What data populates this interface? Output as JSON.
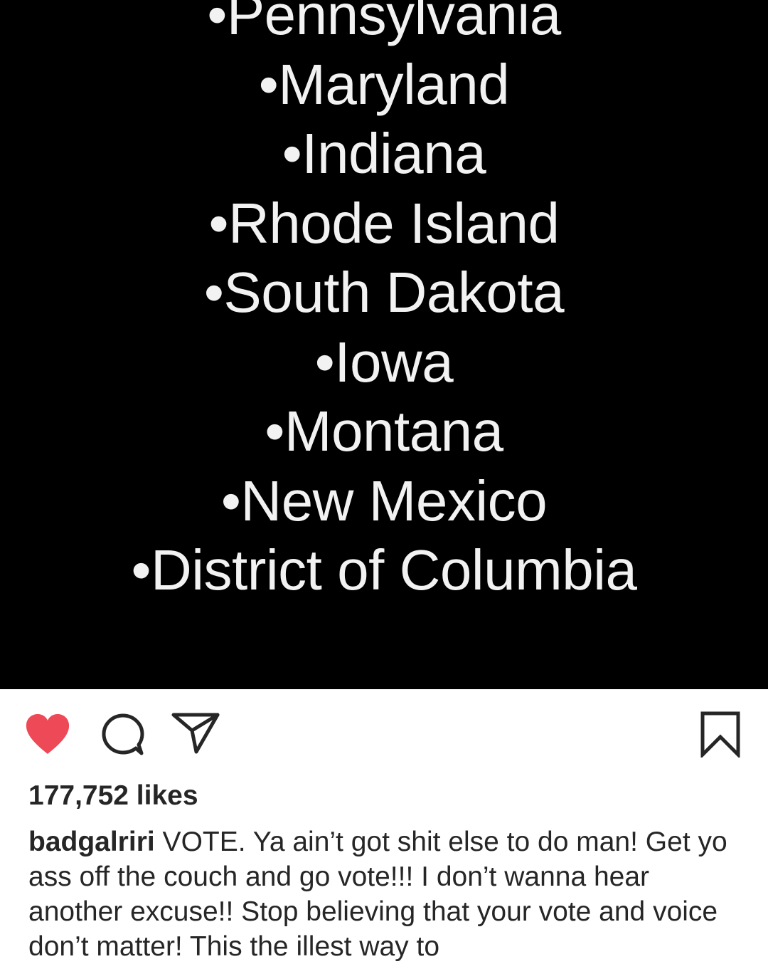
{
  "post": {
    "image": {
      "states": [
        "•Pennsylvania",
        "•Maryland",
        "•Indiana",
        "•Rhode Island",
        "•South Dakota",
        "•Iowa",
        "•Montana",
        "•New Mexico",
        "•District of Columbia"
      ]
    },
    "actions": {
      "like_icon": "heart-filled-icon",
      "comment_icon": "comment-icon",
      "share_icon": "paper-plane-icon",
      "save_icon": "bookmark-icon",
      "liked": true,
      "like_color": "#ed4956"
    },
    "likes_text": "177,752 likes",
    "caption": {
      "username": "badgalriri",
      "text": " VOTE. Ya ain’t got shit else to do man! Get yo ass off the couch and go vote!!! I don’t wanna hear another excuse!! Stop believing that your vote and voice don’t matter! This the illest way to"
    }
  }
}
